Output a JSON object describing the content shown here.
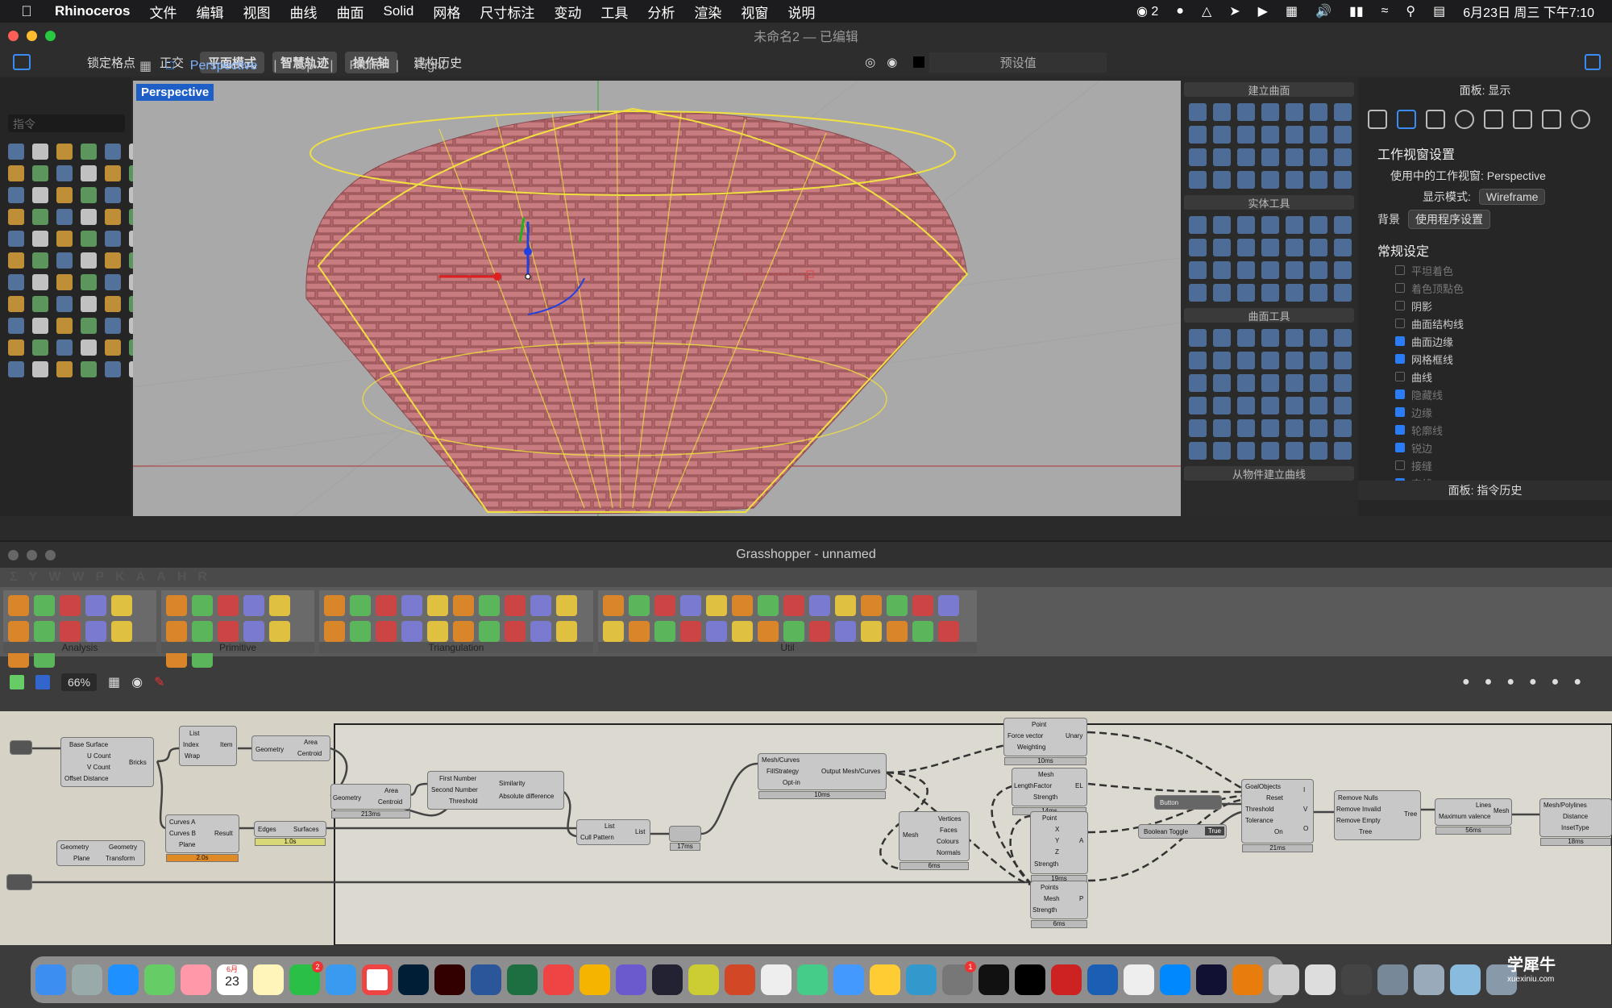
{
  "menubar": {
    "app": "Rhinoceros",
    "items": [
      "文件",
      "编辑",
      "视图",
      "曲线",
      "曲面",
      "Solid",
      "网格",
      "尺寸标注",
      "变动",
      "工具",
      "分析",
      "渲染",
      "视窗",
      "说明"
    ],
    "wechat_count": "2",
    "datetime": "6月23日 周三 下午7:10"
  },
  "rhino": {
    "title": "未命名2",
    "title_status": "— 已编辑",
    "modes": [
      "锁定格点",
      "正交",
      "平面模式",
      "智慧轨迹",
      "操作轴",
      "建构历史"
    ],
    "preset_label": "预设值",
    "view_tabs": [
      "Perspective",
      "Top",
      "Front",
      "Right"
    ],
    "active_view": "Perspective",
    "command_placeholder": "指令",
    "viewport_label": "Perspective"
  },
  "palettes": {
    "build_surface": "建立曲面",
    "solid_tools": "实体工具",
    "surface_tools": "曲面工具",
    "from_object_curve": "从物件建立曲线"
  },
  "panel": {
    "title": "面板: 显示",
    "section1": "工作视窗设置",
    "viewport_label": "使用中的工作视窗:",
    "viewport_value": "Perspective",
    "display_mode_label": "显示模式:",
    "display_mode_value": "Wireframe",
    "background_label": "背景",
    "background_value": "使用程序设置",
    "section2": "常规设定",
    "checks": [
      {
        "label": "平坦着色",
        "checked": false,
        "dim": true
      },
      {
        "label": "着色顶點色",
        "checked": false,
        "dim": true
      },
      {
        "label": "阴影",
        "checked": false,
        "dim": false
      },
      {
        "label": "曲面结构线",
        "checked": false,
        "dim": false
      },
      {
        "label": "曲面边缘",
        "checked": true,
        "dim": false
      },
      {
        "label": "网格框线",
        "checked": true,
        "dim": false
      },
      {
        "label": "曲线",
        "checked": false,
        "dim": false
      },
      {
        "label": "隐藏线",
        "checked": true,
        "dim": true
      },
      {
        "label": "边缘",
        "checked": true,
        "dim": true
      },
      {
        "label": "轮廓线",
        "checked": true,
        "dim": true
      },
      {
        "label": "锐边",
        "checked": true,
        "dim": true
      },
      {
        "label": "接缝",
        "checked": false,
        "dim": true
      },
      {
        "label": "交线",
        "checked": true,
        "dim": true
      }
    ],
    "history_title": "面板: 指令历史"
  },
  "grasshopper": {
    "title": "Grasshopper - unnamed",
    "tabs": [
      "Σ",
      "Y",
      "W",
      "W",
      "P",
      "K",
      "A",
      "A",
      "H",
      "R"
    ],
    "groups": [
      "Analysis",
      "Primitive",
      "Triangulation",
      "Util"
    ],
    "zoom": "66%",
    "nodes": {
      "bricks": {
        "in": [
          "Base Surface",
          "U Count",
          "V Count",
          "Offset Distance"
        ],
        "name": "Bricks"
      },
      "list_item": {
        "in": [
          "List",
          "Index",
          "Wrap"
        ],
        "out": "Item"
      },
      "area1": {
        "in": "Geometry",
        "out": [
          "Area",
          "Centroid"
        ]
      },
      "area2": {
        "in": "Geometry",
        "out": [
          "Area",
          "Centroid"
        ],
        "time": "213ms"
      },
      "similarity": {
        "in": [
          "First Number",
          "Second Number",
          "Threshold"
        ],
        "out": [
          "Similarity",
          "Absolute difference"
        ]
      },
      "curves": {
        "in": [
          "Curves A",
          "Curves B",
          "Plane"
        ],
        "out": "Result",
        "time": "2.0s"
      },
      "edges": {
        "in": "Edges",
        "out": "Surfaces",
        "time": "1.0s"
      },
      "transform": {
        "in": [
          "Geometry",
          "Plane"
        ],
        "out": [
          "Geometry",
          "Transform"
        ]
      },
      "cull": {
        "in": [
          "List",
          "Cull Pattern"
        ],
        "out": "List"
      },
      "cull_time": "17ms",
      "meshcurves": {
        "in": [
          "Mesh/Curves",
          "FillStrategy",
          "Opt-in"
        ],
        "out": "Output Mesh/Curves",
        "time": "10ms"
      },
      "unary": {
        "in": [
          "Point",
          "Force vector",
          "Weighting"
        ],
        "out": "Unary",
        "time": "10ms"
      },
      "el": {
        "in": [
          "Mesh",
          "LengthFactor",
          "Strength"
        ],
        "out": "EL",
        "time": "14ms"
      },
      "anchor": {
        "in": [
          "Point",
          "X",
          "Y",
          "Z",
          "Strength"
        ],
        "out": "A",
        "time": "19ms"
      },
      "pointmesh": {
        "in": [
          "Points",
          "Mesh",
          "Strength"
        ],
        "out": "P",
        "time": "6ms"
      },
      "vertices": {
        "in": "Mesh",
        "out": [
          "Vertices",
          "Faces",
          "Colours",
          "Normals"
        ],
        "time": "6ms"
      },
      "solver": {
        "in": [
          "GoalObjects",
          "Reset",
          "Threshold",
          "Tolerance",
          "On"
        ],
        "out": [
          "I",
          "V",
          "O"
        ],
        "time": "21ms"
      },
      "button": "Button",
      "toggle": "Boolean Toggle",
      "toggle_value": "True",
      "tree": {
        "in": [
          "Remove Nulls",
          "Remove Invalid",
          "Remove Empty",
          "Tree"
        ],
        "out": "Tree"
      },
      "valence": {
        "in": [
          "Lines",
          "Maximum valence"
        ],
        "out": "Mesh",
        "time": "56ms"
      },
      "inset": {
        "in": [
          "Mesh/Polylines",
          "Distance",
          "InsetType"
        ],
        "time": "18ms"
      }
    }
  },
  "dock": {
    "calendar_month": "6月",
    "calendar_day": "23",
    "badge_wechat": "2",
    "badge_settings": "1"
  },
  "watermark": "学犀牛",
  "watermark_site": "xuexiniu.com"
}
